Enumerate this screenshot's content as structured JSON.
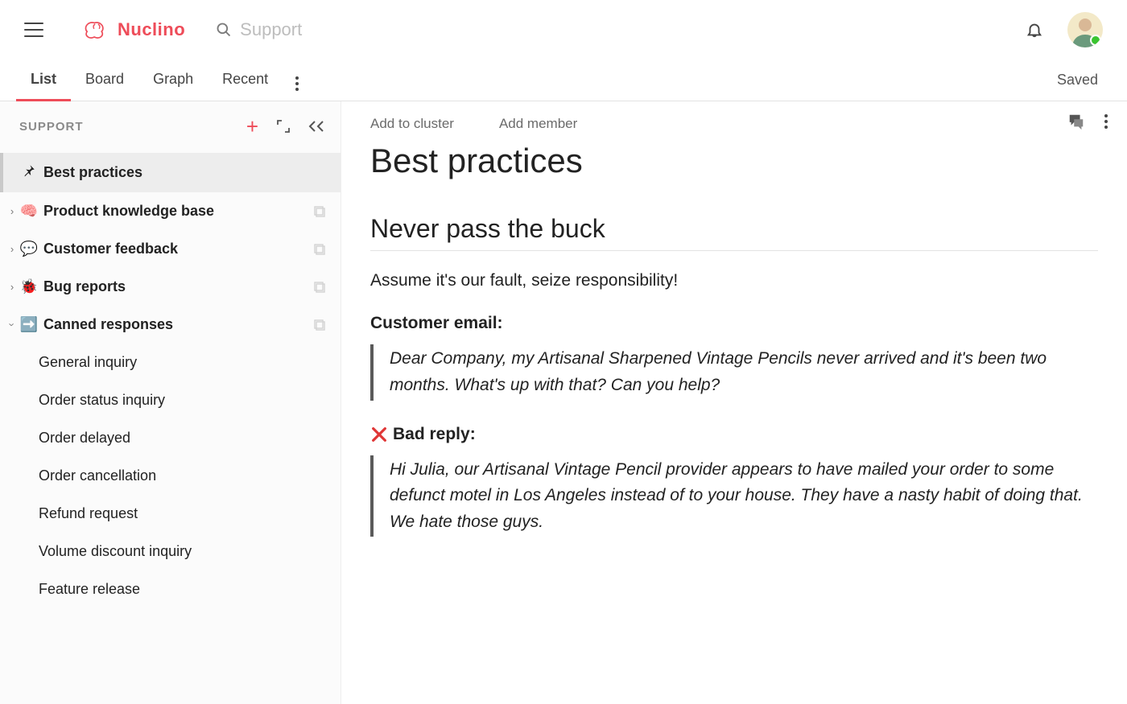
{
  "brand": {
    "name": "Nuclino"
  },
  "search": {
    "placeholder": "Support"
  },
  "tabs": {
    "items": [
      "List",
      "Board",
      "Graph",
      "Recent"
    ],
    "active_index": 0
  },
  "status": {
    "saved": "Saved"
  },
  "sidebar": {
    "title": "SUPPORT",
    "items": [
      {
        "icon": "pin",
        "label": "Best practices",
        "active": true,
        "expandable": false
      },
      {
        "icon": "🧠",
        "label": "Product knowledge base",
        "expandable": true,
        "expanded": false
      },
      {
        "icon": "💬",
        "label": "Customer feedback",
        "expandable": true,
        "expanded": false
      },
      {
        "icon": "🐞",
        "label": "Bug reports",
        "expandable": true,
        "expanded": false
      },
      {
        "icon": "➡️",
        "label": "Canned responses",
        "expandable": true,
        "expanded": true,
        "children": [
          "General inquiry",
          "Order status inquiry",
          "Order delayed",
          "Order cancellation",
          "Refund request",
          "Volume discount inquiry",
          "Feature release"
        ]
      }
    ]
  },
  "doc": {
    "header_links": {
      "add_cluster": "Add to cluster",
      "add_member": "Add member"
    },
    "title": "Best practices",
    "h2": "Never pass the buck",
    "intro": "Assume it's our fault, seize responsibility!",
    "customer_email_label": "Customer email:",
    "customer_email_body": "Dear Company, my Artisanal Sharpened Vintage Pencils never arrived and it's been two months. What's up with that? Can you help?",
    "bad_reply_label": "Bad reply:",
    "bad_reply_body": "Hi Julia, our Artisanal Vintage Pencil provider appears to have mailed your order to some defunct motel in Los Angeles instead of to your house. They have a nasty habit of doing that. We hate those guys."
  },
  "colors": {
    "accent": "#ee4c59"
  }
}
